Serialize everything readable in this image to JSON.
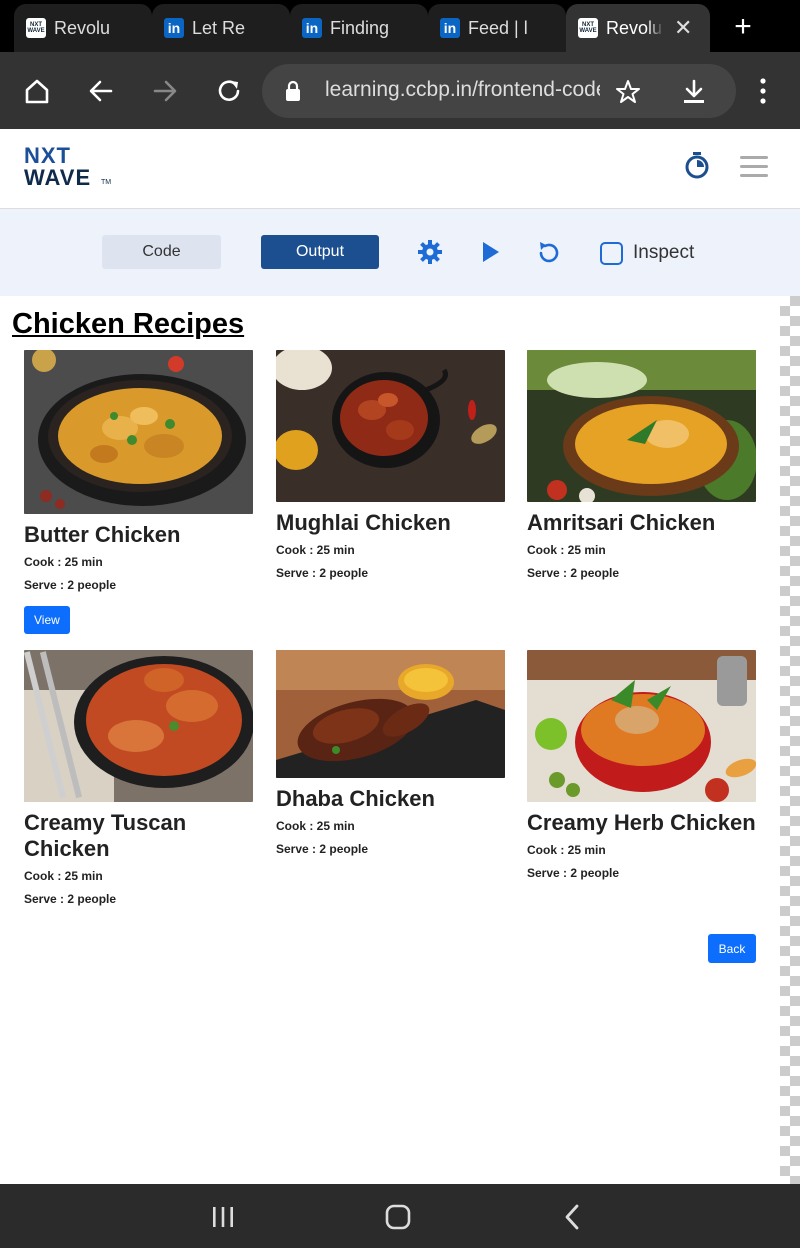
{
  "browser": {
    "tabs": [
      {
        "label": "Revolu",
        "favicon": "nxtwave-favicon",
        "active": false
      },
      {
        "label": "Let Re",
        "favicon": "linkedin-favicon",
        "active": false
      },
      {
        "label": "Finding",
        "favicon": "linkedin-favicon",
        "active": false
      },
      {
        "label": "Feed | l",
        "favicon": "linkedin-favicon",
        "active": false
      },
      {
        "label": "Revolu",
        "favicon": "nxtwave-favicon",
        "active": true
      }
    ],
    "close_glyph": "✕",
    "new_tab_glyph": "+",
    "url": "learning.ccbp.in/frontend-code-playground"
  },
  "site": {
    "logo_line1": "NXT",
    "logo_line2": "WAVE",
    "logo_tm": "TM"
  },
  "controls": {
    "code_label": "Code",
    "output_label": "Output",
    "inspect_label": "Inspect"
  },
  "output": {
    "heading": "Chicken Recipes",
    "recipes": [
      {
        "name": "Butter Chicken",
        "cook": "Cook : 25 min",
        "serve": "Serve : 2 people",
        "view_label": "View"
      },
      {
        "name": "Mughlai Chicken",
        "cook": "Cook : 25 min",
        "serve": "Serve : 2 people"
      },
      {
        "name": "Amritsari Chicken",
        "cook": "Cook : 25 min",
        "serve": "Serve : 2 people"
      },
      {
        "name": "Creamy Tuscan Chicken",
        "cook": "Cook : 25 min",
        "serve": "Serve : 2 people"
      },
      {
        "name": "Dhaba Chicken",
        "cook": "Cook : 25 min",
        "serve": "Serve : 2 people"
      },
      {
        "name": "Creamy Herb Chicken",
        "cook": "Cook : 25 min",
        "serve": "Serve : 2 people"
      }
    ],
    "back_label": "Back"
  },
  "colors": {
    "primary_button": "#0d6efd",
    "output_button": "#1b4f8f",
    "browser_chrome": "#333333"
  }
}
